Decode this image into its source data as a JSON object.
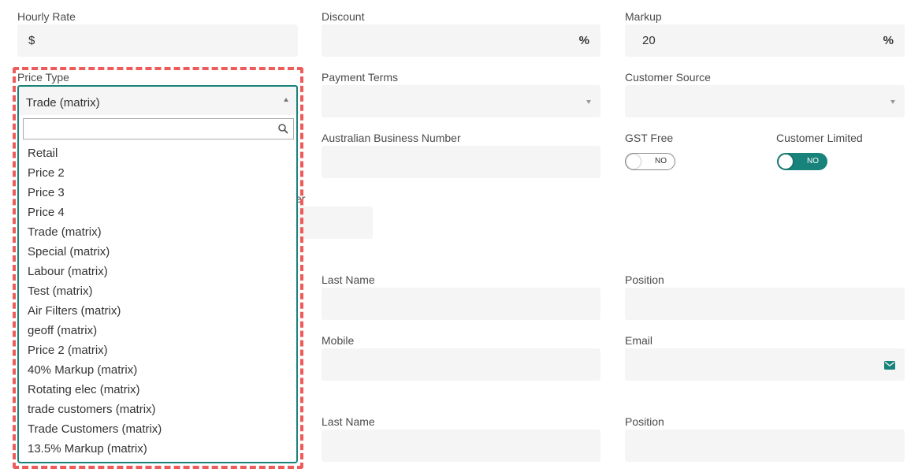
{
  "row1": {
    "hourly_rate": {
      "label": "Hourly Rate",
      "prefix": "$",
      "value": ""
    },
    "discount": {
      "label": "Discount",
      "suffix": "%",
      "value": ""
    },
    "markup": {
      "label": "Markup",
      "suffix": "%",
      "value": "20"
    }
  },
  "row2": {
    "price_type": {
      "label": "Price Type",
      "value": "Trade (matrix)"
    },
    "payment_terms": {
      "label": "Payment Terms",
      "value": ""
    },
    "customer_source": {
      "label": "Customer Source",
      "value": ""
    }
  },
  "row3": {
    "abn": {
      "label": "Australian Business Number",
      "value": ""
    },
    "gst_free": {
      "label": "GST Free",
      "state": "NO",
      "on": false
    },
    "customer_limited": {
      "label": "Customer Limited",
      "state": "NO",
      "on": true
    },
    "partial_label": "er"
  },
  "contact1": {
    "last_name": {
      "label": "Last Name",
      "value": ""
    },
    "position": {
      "label": "Position",
      "value": ""
    },
    "mobile": {
      "label": "Mobile",
      "value": ""
    },
    "email": {
      "label": "Email",
      "value": ""
    }
  },
  "contact2": {
    "last_name": {
      "label": "Last Name",
      "value": ""
    },
    "position": {
      "label": "Position",
      "value": ""
    }
  },
  "dropdown": {
    "search_value": "",
    "options": [
      "Retail",
      "Price 2",
      "Price 3",
      "Price 4",
      "Trade (matrix)",
      "Special (matrix)",
      "Labour (matrix)",
      "Test (matrix)",
      "Air Filters (matrix)",
      "geoff (matrix)",
      "Price 2 (matrix)",
      "40% Markup (matrix)",
      "Rotating elec (matrix)",
      "trade customers (matrix)",
      "Trade Customers (matrix)",
      "13.5% Markup (matrix)"
    ]
  },
  "colors": {
    "accent": "#18837a",
    "highlight": "#ef5a5a",
    "field_bg": "#f5f5f5"
  },
  "icons": {
    "search": "search-icon",
    "email": "envelope-icon"
  }
}
